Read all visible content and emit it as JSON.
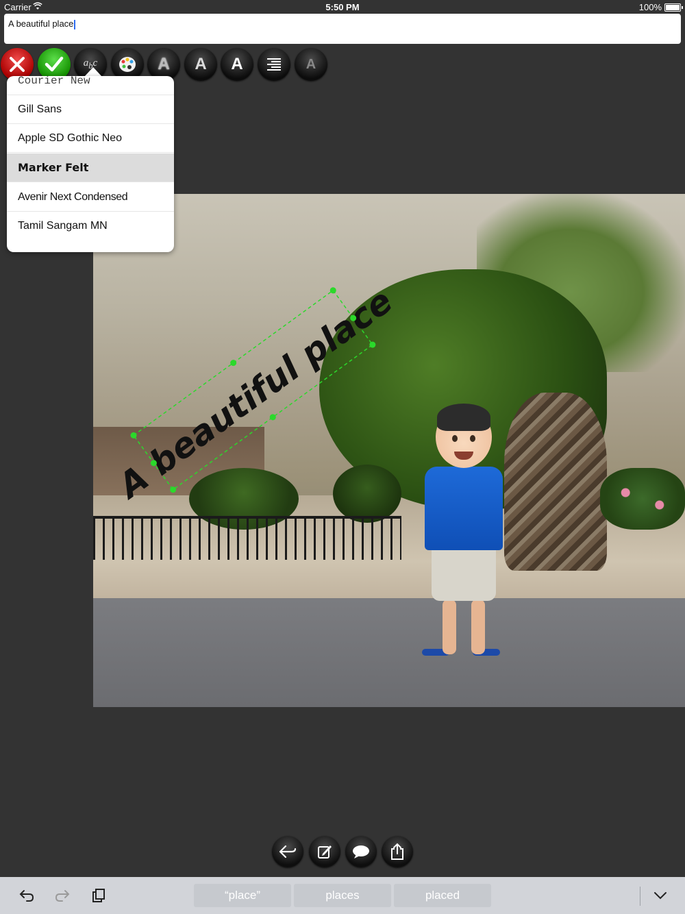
{
  "status_bar": {
    "carrier": "Carrier",
    "time": "5:50 PM",
    "battery": "100%"
  },
  "text_field": {
    "value": "A beautiful place"
  },
  "toolbar": {
    "buttons": [
      "close-icon",
      "checkmark-icon",
      "font-picker-icon",
      "palette-icon",
      "text-outline-icon",
      "text-shadow-icon",
      "text-bold-icon",
      "align-right-icon",
      "text-style-icon"
    ]
  },
  "font_menu": {
    "items": [
      {
        "label": "Courier New",
        "selected": false
      },
      {
        "label": "Gill Sans",
        "selected": false
      },
      {
        "label": "Apple SD Gothic Neo",
        "selected": false
      },
      {
        "label": "Marker Felt",
        "selected": true
      },
      {
        "label": "Avenir Next Condensed",
        "selected": false
      },
      {
        "label": "Tamil Sangam MN",
        "selected": false
      }
    ]
  },
  "photo": {
    "overlay_text": "A beautiful place",
    "handle_color": "#2bd92b"
  },
  "bottom_actions": [
    "back-arrow-icon",
    "edit-icon",
    "speech-bubble-icon",
    "share-icon"
  ],
  "keyboard_bar": {
    "suggestions": [
      "“place”",
      "places",
      "placed"
    ]
  },
  "colors": {
    "background": "#333333",
    "accent_red": "#d40000",
    "accent_green": "#17a400",
    "keyboard_bar": "#d2d4d9"
  }
}
